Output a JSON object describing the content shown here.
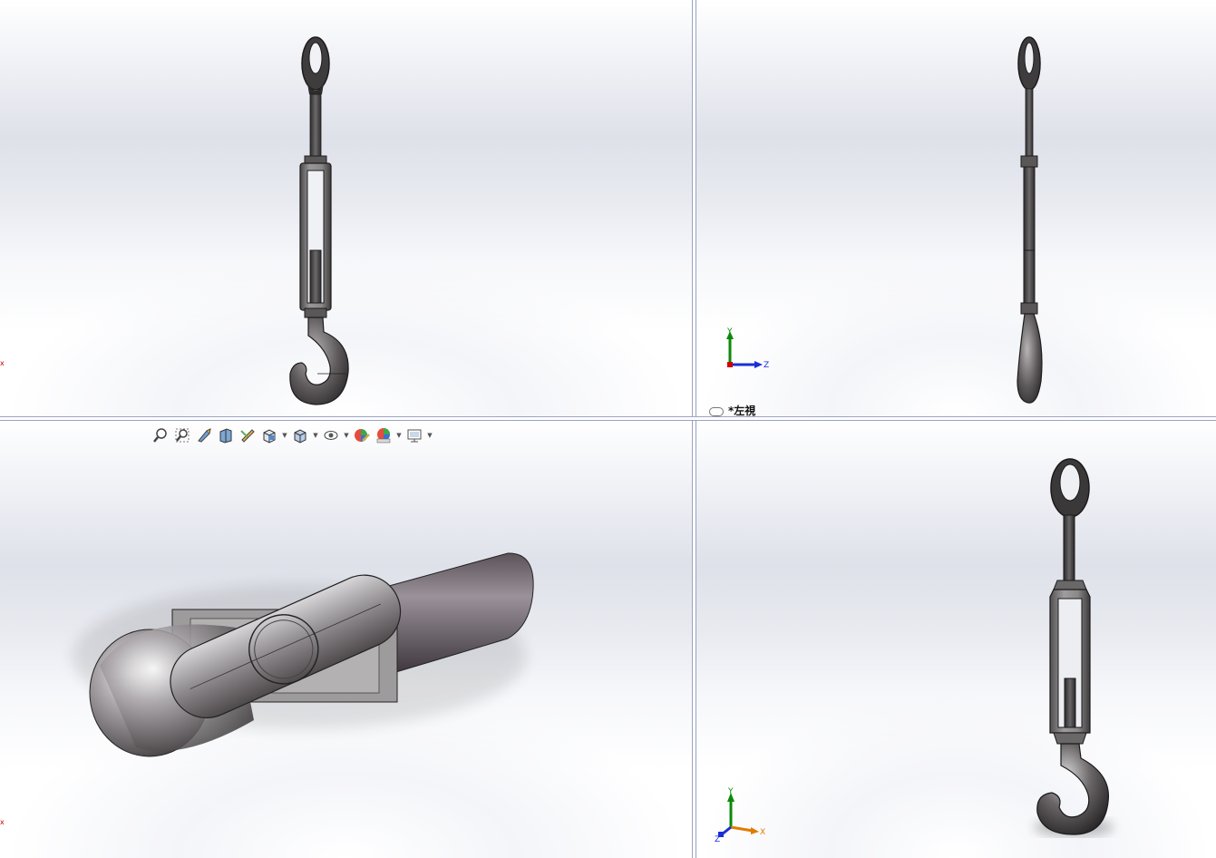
{
  "viewports": {
    "top_left": {
      "name": "front-view",
      "label": ""
    },
    "top_right": {
      "name": "left-view",
      "label": "*左視"
    },
    "bottom_left": {
      "name": "top-view",
      "label": ""
    },
    "bottom_right": {
      "name": "isometric-view",
      "label": ""
    }
  },
  "triads": {
    "left_view": {
      "y": "Y",
      "z": "Z"
    },
    "isometric": {
      "y": "Y",
      "x": "X",
      "z": "Z"
    }
  },
  "view_toolbar": [
    {
      "icon": "zoom-to-fit-icon"
    },
    {
      "icon": "zoom-to-area-icon"
    },
    {
      "icon": "previous-view-icon"
    },
    {
      "icon": "section-view-icon"
    },
    {
      "icon": "dynamic-annotation-icon"
    },
    {
      "icon": "view-orientation-icon",
      "dropdown": true
    },
    {
      "icon": "display-style-icon",
      "dropdown": true
    },
    {
      "icon": "hide-show-items-icon",
      "dropdown": true
    },
    {
      "icon": "edit-appearance-icon"
    },
    {
      "icon": "apply-scene-icon",
      "dropdown": true
    },
    {
      "icon": "view-settings-icon",
      "dropdown": true
    }
  ],
  "colors": {
    "steel_dark": "#4a4748",
    "steel_mid": "#7d797b",
    "steel_light": "#c9c6c8",
    "axis_red": "#cc0000",
    "axis_green": "#0a8a0a",
    "axis_blue": "#1a2fd6",
    "axis_orange": "#e07b00",
    "separator": "#9aa3c0"
  }
}
